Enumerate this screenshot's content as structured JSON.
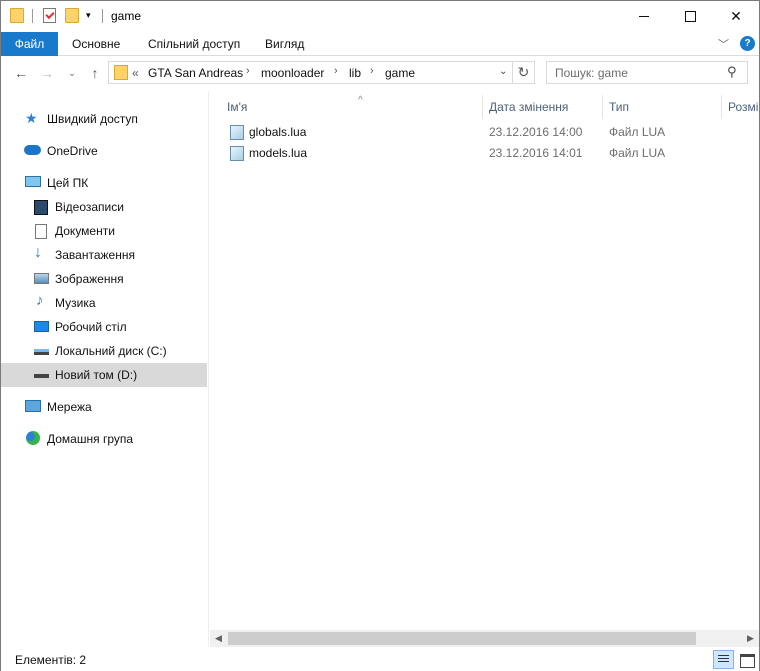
{
  "window": {
    "title": "game",
    "controls": {
      "minimize": "",
      "maximize": "",
      "close": "✕"
    }
  },
  "ribbon": {
    "tabs": [
      "Файл",
      "Основне",
      "Спільний доступ",
      "Вигляд"
    ],
    "help": "?"
  },
  "address": {
    "overflow": "«",
    "crumbs": [
      "GTA San Andreas",
      "moonloader",
      "lib",
      "game"
    ],
    "separator": "›"
  },
  "search": {
    "placeholder": "Пошук: game"
  },
  "sidebar": {
    "items": [
      {
        "label": "Швидкий доступ",
        "icon": "star-icon"
      },
      {
        "label": "OneDrive",
        "icon": "onedrive-icon"
      },
      {
        "label": "Цей ПК",
        "icon": "computer-icon"
      },
      {
        "label": "Відеозаписи",
        "icon": "videos-icon"
      },
      {
        "label": "Документи",
        "icon": "documents-icon"
      },
      {
        "label": "Завантаження",
        "icon": "downloads-icon"
      },
      {
        "label": "Зображення",
        "icon": "pictures-icon"
      },
      {
        "label": "Музика",
        "icon": "music-icon"
      },
      {
        "label": "Робочий стіл",
        "icon": "desktop-icon"
      },
      {
        "label": "Локальний диск (C:)",
        "icon": "local-disk-icon"
      },
      {
        "label": "Новий том (D:)",
        "icon": "drive-icon",
        "selected": true
      },
      {
        "label": "Мережа",
        "icon": "network-icon"
      },
      {
        "label": "Домашня група",
        "icon": "homegroup-icon"
      }
    ]
  },
  "columns": [
    "Ім'я",
    "Дата змінення",
    "Тип",
    "Розмі"
  ],
  "files": [
    {
      "name": "globals.lua",
      "date": "23.12.2016 14:00",
      "type": "Файл LUA"
    },
    {
      "name": "models.lua",
      "date": "23.12.2016 14:01",
      "type": "Файл LUA"
    }
  ],
  "status": {
    "count": "Елементів: 2"
  },
  "colors": {
    "accent": "#1979ca",
    "selected": "#d9d9d9",
    "header_text": "#4c607a"
  }
}
